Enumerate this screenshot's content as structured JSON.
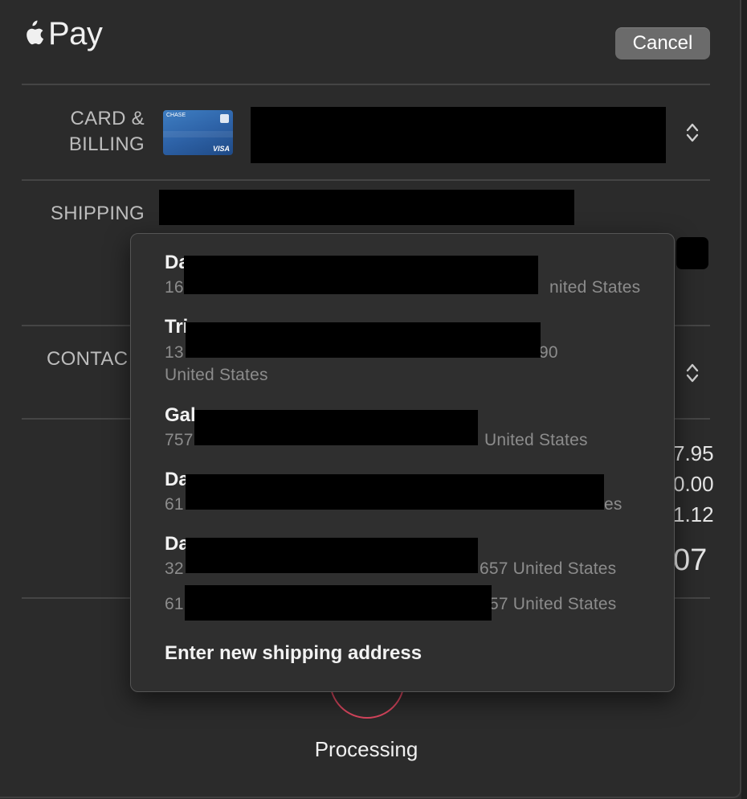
{
  "header": {
    "brand": "Pay",
    "cancel_label": "Cancel"
  },
  "sections": {
    "card_label": "CARD &\nBILLING",
    "shipping_label": "SHIPPING",
    "contact_label": "CONTAC"
  },
  "card": {
    "bank_text": "CHASE",
    "network": "VISA"
  },
  "totals_partial": [
    "7.95",
    "0.00",
    "1.12",
    "07"
  ],
  "shipping_menu": {
    "addresses": [
      {
        "name_prefix": "Da",
        "line1_prefix": "16",
        "line1_suffix": "nited States",
        "line2": ""
      },
      {
        "name_prefix": "Tri",
        "line1_prefix": "13",
        "line1_suffix": "90",
        "line2": "United States"
      },
      {
        "name_prefix": "Gal",
        "line1_prefix": "757",
        "line1_suffix": "United States",
        "line2": ""
      },
      {
        "name_prefix": "Da",
        "line1_prefix": "61",
        "line1_suffix": "es",
        "line2": ""
      },
      {
        "name_prefix": "Da",
        "line1_prefix": "32",
        "line1_suffix": "657 United States",
        "line2": ""
      }
    ],
    "extra_line": {
      "prefix": "61",
      "suffix": "57 United States"
    },
    "new_address_label": "Enter new shipping address"
  },
  "status": {
    "processing_label": "Processing"
  },
  "colors": {
    "background": "#2b2b2b",
    "popup": "#2f2f2f",
    "cancel_button": "#6b6b6b",
    "spinner": "#d9465e"
  }
}
